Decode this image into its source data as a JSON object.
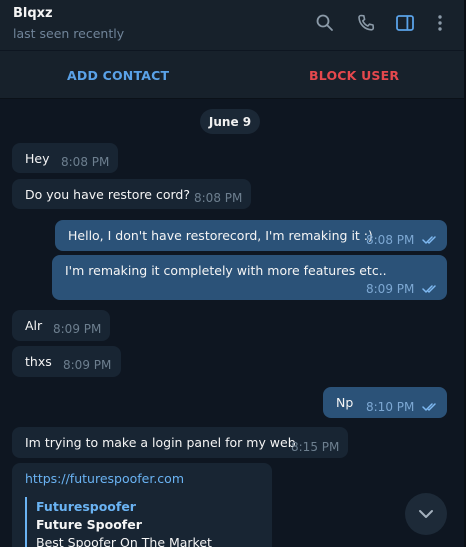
{
  "header": {
    "name": "Blqxz",
    "status": "last seen recently",
    "icons": [
      "search-icon",
      "phone-icon",
      "sidebar-toggle-icon",
      "more-vertical-icon"
    ]
  },
  "actions": {
    "add_contact": "ADD CONTACT",
    "block_user": "BLOCK USER"
  },
  "date_separator": "June 9",
  "messages": [
    {
      "dir": "in",
      "text": "Hey",
      "time": "8:08 PM"
    },
    {
      "dir": "in",
      "text": "Do you have restore cord?",
      "time": "8:08 PM"
    },
    {
      "dir": "out",
      "text": "Hello, I don't have restorecord, I'm remaking it :)",
      "time": "8:08 PM",
      "read": true
    },
    {
      "dir": "out",
      "text": "I'm remaking it completely with more features etc..",
      "time": "8:09 PM",
      "read": true
    },
    {
      "dir": "in",
      "text": "Alr",
      "time": "8:09 PM"
    },
    {
      "dir": "in",
      "text": "thxs",
      "time": "8:09 PM"
    },
    {
      "dir": "out",
      "text": "Np",
      "time": "8:10 PM",
      "read": true
    },
    {
      "dir": "in",
      "text": "Im trying to make a login panel for my web",
      "time": "8:15 PM"
    }
  ],
  "link_message": {
    "url": "https://futurespoofer.com",
    "preview_site": "Futurespoofer",
    "preview_title": "Future Spoofer",
    "preview_description": "Best Spoofer On The Market"
  },
  "colors": {
    "background": "#0e1621",
    "header": "#17212b",
    "incoming_bubble": "#182533",
    "outgoing_bubble": "#2b5278",
    "accent": "#5aa2e8",
    "danger": "#e5484d"
  }
}
